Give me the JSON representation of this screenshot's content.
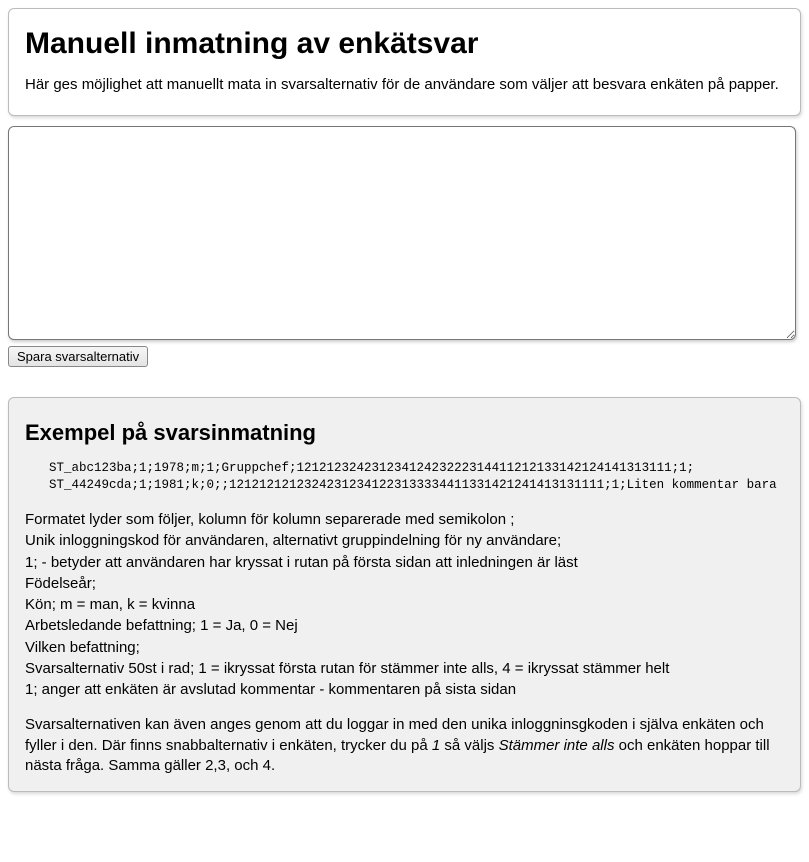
{
  "header": {
    "title": "Manuell inmatning av enkätsvar",
    "description": "Här ges möjlighet att manuellt mata in svarsalternativ för de användare som väljer att besvara enkäten på papper."
  },
  "input": {
    "textarea_value": "",
    "save_button_label": "Spara svarsalternativ"
  },
  "example": {
    "title": "Exempel på svarsinmatning",
    "code_line1": "ST_abc123ba;1;1978;m;1;Gruppchef;12121232423123412423222314411212133142124141313111;1;",
    "code_line2": "ST_44249cda;1;1981;k;0;;12121212123242312341223133334411331421241413131111;1;Liten kommentar bara",
    "format_intro": "Formatet lyder som följer, kolumn för kolumn separerade med semikolon ;",
    "line_login": "Unik inloggningskod för användaren, alternativt gruppindelning för ny användare;",
    "line_checked": "1; - betyder att användaren har kryssat i rutan på första sidan att inledningen är läst",
    "line_birth": "Födelseår;",
    "line_gender": "Kön; m = man, k = kvinna",
    "line_lead": "Arbetsledande befattning; 1 = Ja, 0 = Nej",
    "line_role": "Vilken befattning;",
    "line_answers": "Svarsalternativ 50st i rad; 1 = ikryssat första rutan för stämmer inte alls, 4 = ikryssat stämmer helt",
    "line_done": "1; anger att enkäten är avslutad kommentar - kommentaren på sista sidan",
    "footer_p1": "Svarsalternativen kan även anges genom att du loggar in med den unika inloggninsgkoden i själva enkäten och fyller i den. Där finns snabbalternativ i enkäten, trycker du på ",
    "footer_em1": "1",
    "footer_p2": " så väljs ",
    "footer_em2": "Stämmer inte alls",
    "footer_p3": " och enkäten hoppar till nästa fråga. Samma gäller 2,3, och 4."
  }
}
